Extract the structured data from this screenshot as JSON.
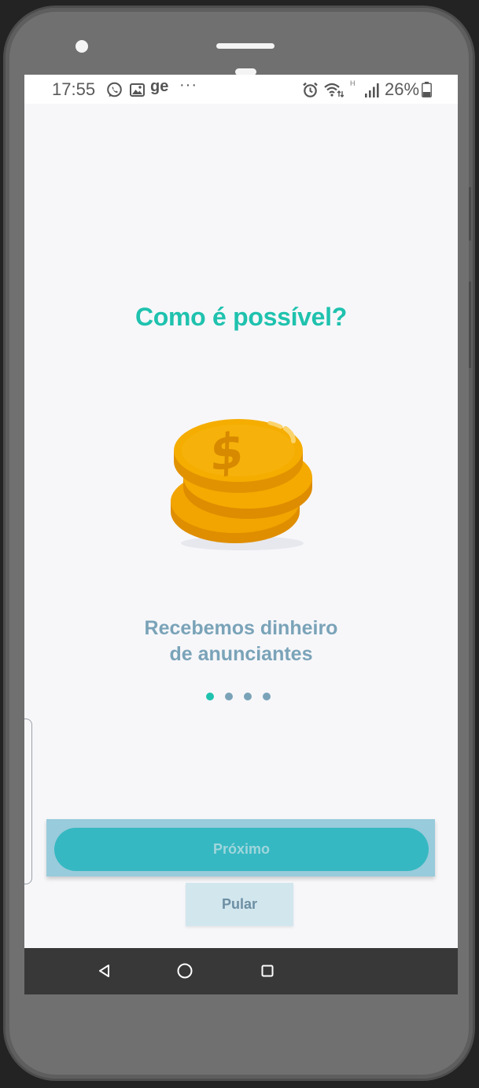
{
  "status_bar": {
    "time": "17:55",
    "notification_icons": [
      "whatsapp-icon",
      "image-icon"
    ],
    "carrier_text": "ge",
    "more_indicator": "···",
    "network_type": "H",
    "battery_percent": "26%",
    "system_icons": [
      "alarm-icon",
      "wifi-icon",
      "signal-icon",
      "battery-icon"
    ]
  },
  "onboarding": {
    "title": "Como é possível?",
    "illustration": "coins-icon",
    "subtitle_line1": "Recebemos dinheiro",
    "subtitle_line2": "de anunciantes",
    "page_count": 4,
    "active_page": 1
  },
  "actions": {
    "next_label": "Próximo",
    "skip_label": "Pular"
  },
  "nav_bar": {
    "buttons": [
      "back-icon",
      "home-icon",
      "recents-icon"
    ]
  },
  "colors": {
    "accent": "#1fc2ae",
    "subtitle": "#7aa3b8",
    "button": "#36b8c2",
    "coin": "#f5a800"
  }
}
